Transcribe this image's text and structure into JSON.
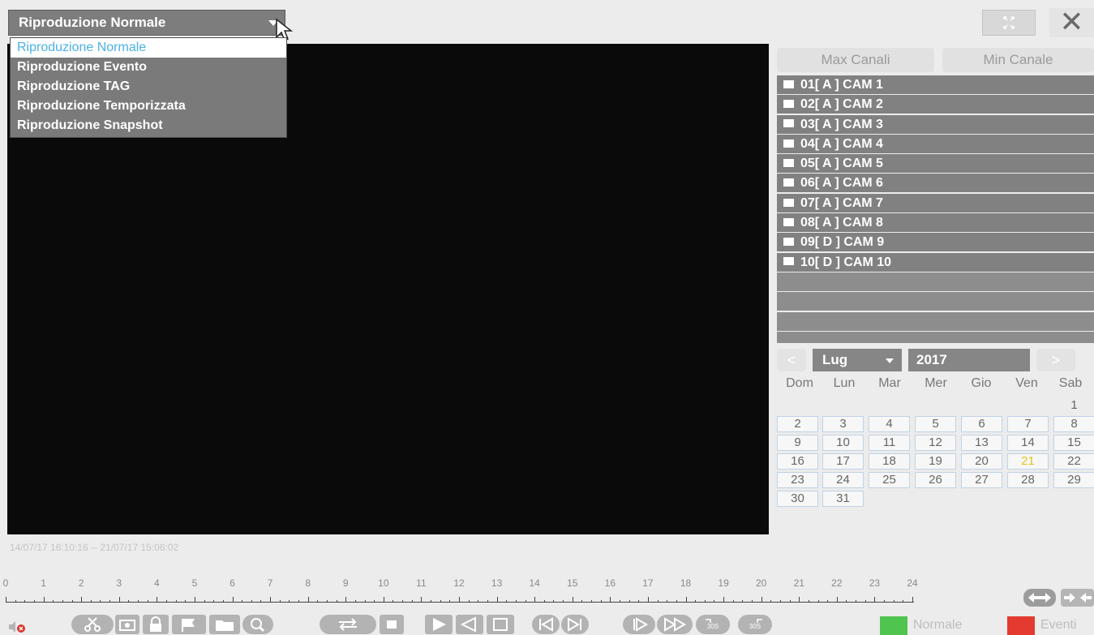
{
  "mode": {
    "selected": "Riproduzione Normale",
    "options": [
      "Riproduzione Normale",
      "Riproduzione Evento",
      "Riproduzione TAG",
      "Riproduzione Temporizzata",
      "Riproduzione Snapshot"
    ]
  },
  "window": {
    "close_label": "✕"
  },
  "panel": {
    "max_channels_label": "Max Canali",
    "min_channel_label": "Min Canale",
    "channels": [
      "01[ A ] CAM 1",
      "02[ A ] CAM 2",
      "03[ A ] CAM 3",
      "04[ A ] CAM 4",
      "05[ A ] CAM 5",
      "06[ A ] CAM 6",
      "07[ A ] CAM 7",
      "08[ A ] CAM 8",
      "09[ D ] CAM 9",
      "10[ D ] CAM 10"
    ]
  },
  "calendar": {
    "prev": "<",
    "next": ">",
    "month": "Lug",
    "year": "2017",
    "weekdays": [
      "Dom",
      "Lun",
      "Mar",
      "Mer",
      "Gio",
      "Ven",
      "Sab"
    ],
    "first_weekday_index": 6,
    "days_in_month": 31,
    "highlighted_day": 21
  },
  "playback": {
    "range": "14/07/17 16:10:16 -- 21/07/17 15:06:02",
    "hours": [
      "0",
      "1",
      "2",
      "3",
      "4",
      "5",
      "6",
      "7",
      "8",
      "9",
      "10",
      "11",
      "12",
      "13",
      "14",
      "15",
      "16",
      "17",
      "18",
      "19",
      "20",
      "21",
      "22",
      "23",
      "24"
    ]
  },
  "legend": {
    "normal_label": "Normale",
    "event_label": "Eventi",
    "normal_color": "#4fc44f",
    "event_color": "#e33b30"
  },
  "toolbar": {
    "icons": [
      "mute-icon",
      "cut-icon",
      "snapshot-icon",
      "lock-icon",
      "tag-icon",
      "folder-icon",
      "zoom-icon",
      "sync-icon",
      "stop-icon",
      "play-icon",
      "reverse-icon",
      "pause-icon",
      "prev-frame-icon",
      "next-frame-icon",
      "slow-icon",
      "fast-icon",
      "skip-back-30-icon",
      "skip-forward-30-icon"
    ],
    "skip_back_label": "30S",
    "skip_forward_label": "30S"
  }
}
